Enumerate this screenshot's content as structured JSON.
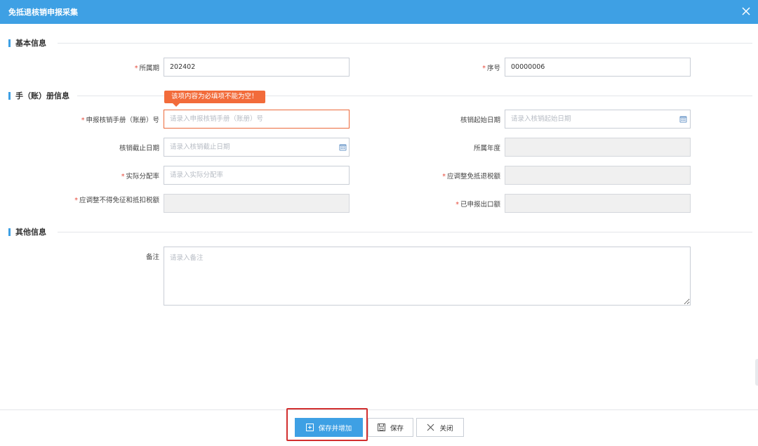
{
  "window": {
    "title": "免抵退核销申报采集"
  },
  "sections": {
    "basic": "基本信息",
    "manual": "手（账）册信息",
    "other": "其他信息"
  },
  "basic": {
    "period_label": "所属期",
    "period_value": "202402",
    "seq_label": "序号",
    "seq_value": "00000006"
  },
  "manual": {
    "tooltip": "该项内容为必填项不能为空！",
    "manual_no_label": "申报核销手册（账册）号",
    "manual_no_placeholder": "请录入申报核销手册（账册）号",
    "start_date_label": "核销起始日期",
    "start_date_placeholder": "请录入核销起始日期",
    "end_date_label": "核销截止日期",
    "end_date_placeholder": "请录入核销截止日期",
    "year_label": "所属年度",
    "rate_label": "实际分配率",
    "rate_placeholder": "请录入实际分配率",
    "adj_refund_label": "应调整免抵退税额",
    "adj_nocredit_label": "应调整不得免征和抵扣税额",
    "declared_export_label": "已申报出口额"
  },
  "other": {
    "remark_label": "备注",
    "remark_placeholder": "请录入备注"
  },
  "footer": {
    "save_add": "保存并增加",
    "save": "保存",
    "close": "关闭"
  },
  "colors": {
    "accent": "#3ea0e4",
    "error": "#f26b3a",
    "required": "#e64a3b",
    "highlight": "#d22f2f"
  }
}
